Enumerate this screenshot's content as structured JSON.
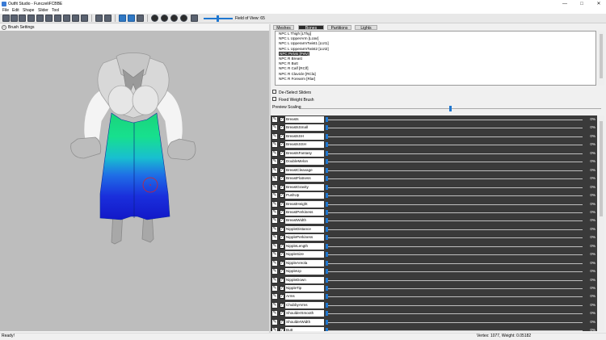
{
  "window": {
    "title": "Outfit Studio - FunczeliFCBBE",
    "minimize": "—",
    "maximize": "□",
    "close": "✕"
  },
  "menu": [
    "File",
    "Edit",
    "Shape",
    "Slider",
    "Tool"
  ],
  "toolbar": {
    "fov_label": "Field of View: 65",
    "fov_value": 65
  },
  "brush": {
    "label": "Brush Settings",
    "toggle": "-"
  },
  "tabs": [
    {
      "label": "Meshes",
      "active": false
    },
    {
      "label": "Bones",
      "active": true
    },
    {
      "label": "Partitions",
      "active": false
    },
    {
      "label": "Lights",
      "active": false
    }
  ],
  "bones": [
    "NPC L Thigh [LThg]",
    "NPC L UpperArm [LUar]",
    "NPC L UpperarmTwist1 [LUt1]",
    "NPC L UpperarmTwist2 [LUt2]",
    "NPC Pelvis [Pelv]",
    "NPC R Breast",
    "NPC R Butt",
    "NPC R Calf [RClf]",
    "NPC R Clavicle [RCla]",
    "NPC R Forearm [Rlar]"
  ],
  "selected_bone": "NPC Pelvis [Pelv]",
  "options": {
    "deselect": "De-/Select Sliders",
    "fixed_weight": "Fixed Weight Brush",
    "preview_scaling": "Preview Scaling"
  },
  "sliders": [
    {
      "name": "Breasts",
      "value": "0%"
    },
    {
      "name": "BreastsSmall",
      "value": "0%"
    },
    {
      "name": "BreastsSH",
      "value": "0%"
    },
    {
      "name": "BreastsSSH",
      "value": "0%"
    },
    {
      "name": "BreastsFantasy",
      "value": "0%"
    },
    {
      "name": "DoubleMelon",
      "value": "0%"
    },
    {
      "name": "BreastCleavage",
      "value": "0%"
    },
    {
      "name": "BreastFlatness",
      "value": "0%"
    },
    {
      "name": "BreastGravity",
      "value": "0%"
    },
    {
      "name": "PushUp",
      "value": "0%"
    },
    {
      "name": "BreastHeight",
      "value": "0%"
    },
    {
      "name": "BreastPerkiness",
      "value": "0%"
    },
    {
      "name": "BreastWidth",
      "value": "0%"
    },
    {
      "name": "NippleDistance",
      "value": "0%"
    },
    {
      "name": "NipplePerkiness",
      "value": "0%"
    },
    {
      "name": "NippleLength",
      "value": "0%"
    },
    {
      "name": "NippleSize",
      "value": "0%"
    },
    {
      "name": "NippleAreola",
      "value": "0%"
    },
    {
      "name": "NippleUp",
      "value": "0%"
    },
    {
      "name": "NippleDown",
      "value": "0%"
    },
    {
      "name": "NippleTip",
      "value": "0%"
    },
    {
      "name": "Arms",
      "value": "0%"
    },
    {
      "name": "ChubbyArms",
      "value": "0%"
    },
    {
      "name": "ShoulderSmooth",
      "value": "0%"
    },
    {
      "name": "ShoulderWidth",
      "value": "0%"
    },
    {
      "name": "Butt",
      "value": "0%"
    }
  ],
  "status": {
    "left": "Ready!",
    "right": "Vertex: 1077, Weight: 0.05182"
  },
  "colors": {
    "accent": "#1f77d0",
    "viewport_bg": "#bdbdbd",
    "slider_bg": "#3a3a3a"
  }
}
